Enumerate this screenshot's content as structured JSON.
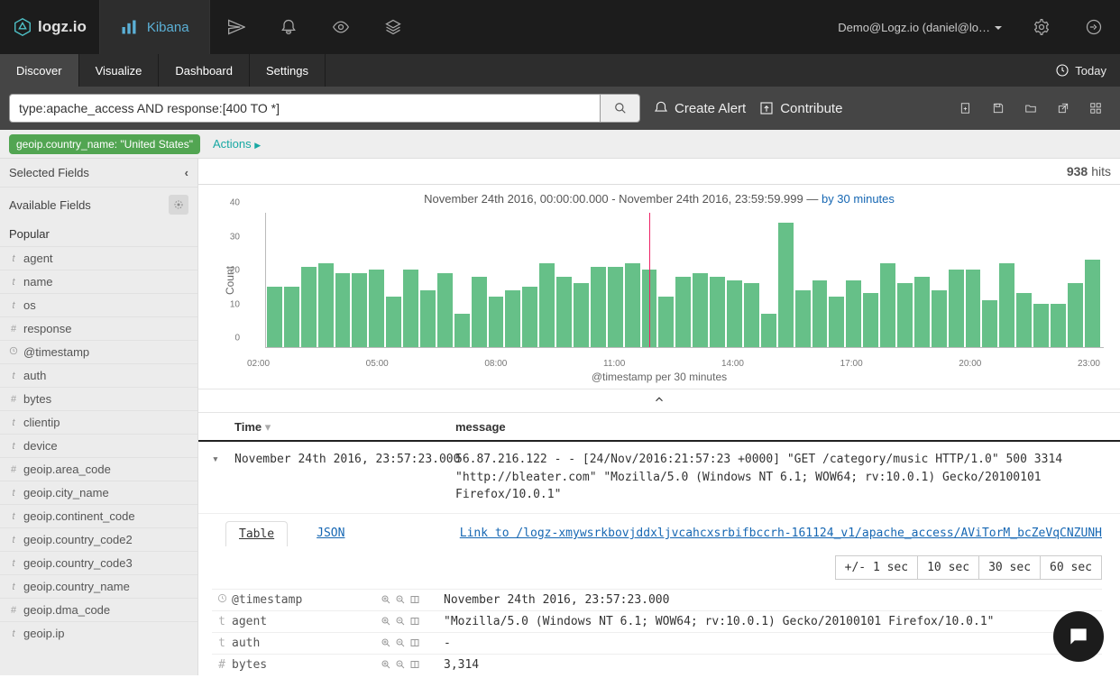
{
  "header": {
    "logo_text": "logz.io",
    "app_tab": "Kibana",
    "account_label": "Demo@Logz.io (daniel@lo…"
  },
  "nav": {
    "items": [
      "Discover",
      "Visualize",
      "Dashboard",
      "Settings"
    ],
    "active": "Discover",
    "time_label": "Today"
  },
  "query": {
    "value": "type:apache_access AND response:[400 TO *]",
    "create_alert": "Create Alert",
    "contribute": "Contribute"
  },
  "filters": {
    "pill": "geoip.country_name: \"United States\"",
    "actions_label": "Actions"
  },
  "sidebar": {
    "selected_label": "Selected Fields",
    "available_label": "Available Fields",
    "popular_label": "Popular",
    "fields": [
      {
        "type": "t",
        "name": "agent"
      },
      {
        "type": "t",
        "name": "name"
      },
      {
        "type": "t",
        "name": "os"
      },
      {
        "type": "#",
        "name": "response"
      },
      {
        "type": "clock",
        "name": "@timestamp"
      },
      {
        "type": "t",
        "name": "auth"
      },
      {
        "type": "#",
        "name": "bytes"
      },
      {
        "type": "t",
        "name": "clientip"
      },
      {
        "type": "t",
        "name": "device"
      },
      {
        "type": "#",
        "name": "geoip.area_code"
      },
      {
        "type": "t",
        "name": "geoip.city_name"
      },
      {
        "type": "t",
        "name": "geoip.continent_code"
      },
      {
        "type": "t",
        "name": "geoip.country_code2"
      },
      {
        "type": "t",
        "name": "geoip.country_code3"
      },
      {
        "type": "t",
        "name": "geoip.country_name"
      },
      {
        "type": "#",
        "name": "geoip.dma_code"
      },
      {
        "type": "t",
        "name": "geoip.ip"
      }
    ]
  },
  "hits": {
    "count": "938",
    "label": "hits"
  },
  "range_line": {
    "range": "November 24th 2016, 00:00:00.000 - November 24th 2016, 23:59:59.999",
    "sep": " — ",
    "interval": "by 30 minutes"
  },
  "chart_data": {
    "type": "bar",
    "title": "",
    "xlabel": "@timestamp per 30 minutes",
    "ylabel": "Count",
    "ylim": [
      0,
      40
    ],
    "yticks": [
      0,
      10,
      20,
      30,
      40
    ],
    "xticks": [
      "02:00",
      "05:00",
      "08:00",
      "11:00",
      "14:00",
      "17:00",
      "20:00",
      "23:00"
    ],
    "redline_index": 22,
    "values": [
      18,
      18,
      24,
      25,
      22,
      22,
      23,
      15,
      23,
      17,
      22,
      10,
      21,
      15,
      17,
      18,
      25,
      21,
      19,
      24,
      24,
      25,
      23,
      15,
      21,
      22,
      21,
      20,
      19,
      10,
      37,
      17,
      20,
      15,
      20,
      16,
      25,
      19,
      21,
      17,
      23,
      23,
      14,
      25,
      16,
      13,
      13,
      19,
      26
    ]
  },
  "doc_headers": {
    "time": "Time",
    "message": "message"
  },
  "docs": [
    {
      "time": "November 24th 2016, 23:57:23.000",
      "message": "56.87.216.122 - - [24/Nov/2016:21:57:23 +0000] \"GET /category/music HTTP/1.0\" 500 3314 \"http://bleater.com\" \"Mozilla/5.0 (Windows NT 6.1; WOW64; rv:10.0.1) Gecko/20100101 Firefox/10.0.1\""
    }
  ],
  "expanded": {
    "tabs": {
      "table": "Table",
      "json": "JSON"
    },
    "link_text": "Link to /logz-xmywsrkbovjddxljvcahcxsrbifbccrh-161124_v1/apache_access/AViTorM_bcZeVqCNZUNH",
    "sec_buttons": [
      "+/-  1 sec",
      "10 sec",
      "30 sec",
      "60 sec"
    ],
    "rows": [
      {
        "type": "clock",
        "name": "@timestamp",
        "val": "November 24th 2016, 23:57:23.000"
      },
      {
        "type": "t",
        "name": "agent",
        "val": "\"Mozilla/5.0 (Windows NT 6.1; WOW64; rv:10.0.1) Gecko/20100101 Firefox/10.0.1\""
      },
      {
        "type": "t",
        "name": "auth",
        "val": "-"
      },
      {
        "type": "#",
        "name": "bytes",
        "val": "3,314"
      }
    ]
  }
}
